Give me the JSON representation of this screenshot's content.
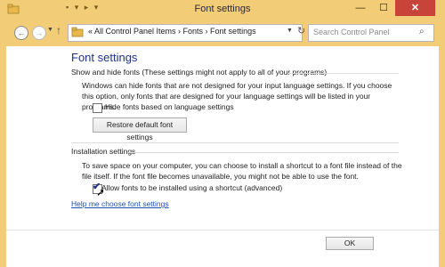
{
  "window": {
    "title": "Font settings",
    "minimize_glyph": "—",
    "maximize_glyph": "☐",
    "close_glyph": "✕",
    "title_controls": "▪ ▾ ▸ ▾",
    "frame_color": "#f2cc76"
  },
  "nav": {
    "back_glyph": "←",
    "forward_glyph": "→",
    "dropdown_glyph": "▼",
    "up_glyph": "↑",
    "breadcrumb": "«  All Control Panel Items  ›  Fonts  ›  Font settings",
    "address_dropdown_glyph": "▼",
    "refresh_glyph": "↻",
    "search_placeholder": "Search Control Panel",
    "search_glyph": "⌕"
  },
  "page": {
    "title": "Font settings",
    "show_hide": {
      "heading": "Show and hide fonts (These settings might not apply to all of your programs)",
      "description": "Windows can hide fonts that are not designed for your input language settings. If you choose this option, only fonts that are designed for your language settings will be listed in your programs.",
      "checkbox_label": "Hide fonts based on language settings",
      "checkbox_checked": false,
      "restore_button": "Restore default font settings"
    },
    "installation": {
      "heading": "Installation settings",
      "description": "To save space on your computer, you can choose to install a shortcut to a font file instead of the file itself. If the font file becomes unavailable, you might not be able to use the font.",
      "checkbox_label": "Allow fonts to be installed using a shortcut (advanced)",
      "checkbox_checked": true,
      "check_glyph": "✔"
    },
    "help_link": "Help me choose font settings",
    "ok_button": "OK",
    "cursor_glyph": "➚"
  },
  "colors": {
    "title_blue": "#1e3287",
    "link_blue": "#1e50b4",
    "close_red": "#c8443a"
  }
}
